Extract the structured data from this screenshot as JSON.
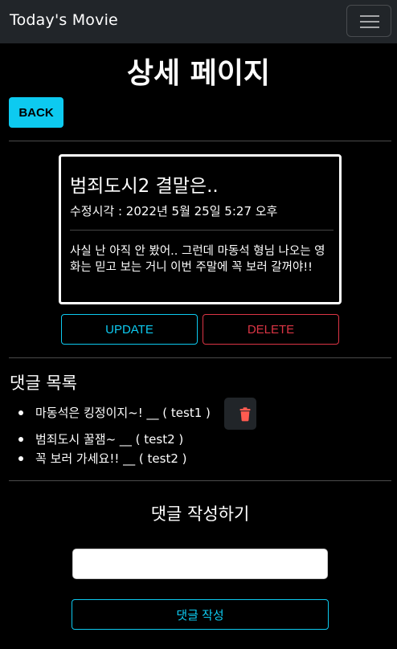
{
  "navbar": {
    "brand": "Today's Movie",
    "menu_icon": "hamburger-menu-icon"
  },
  "page": {
    "title": "상세 페이지",
    "back_label": "BACK"
  },
  "post": {
    "title": "범죄도시2 결말은..",
    "modified": "수정시각 : 2022년 5월 25일 5:27 오후",
    "body": "사실 난 아직 안 봤어.. 그런데 마동석 형님 나오는 영화는 믿고 보는 거니 이번 주말에 꼭 보러 갈꺼야!!",
    "update_label": "UPDATE",
    "delete_label": "DELETE"
  },
  "comments": {
    "heading": "댓글 목록",
    "items": [
      {
        "text": "마동석은 킹정이지~! __ ( test1 )"
      },
      {
        "text": "범죄도시 꿀잼~ __ ( test2 )"
      },
      {
        "text": "꼭 보러 가세요!! __ ( test2 )"
      }
    ],
    "delete_icon": "trash-icon"
  },
  "comment_form": {
    "heading": "댓글 작성하기",
    "input_value": "",
    "input_placeholder": "",
    "submit_label": "댓글 작성"
  },
  "colors": {
    "accent": "#0dcaf0",
    "danger": "#dc3545",
    "navbar_bg": "#212529",
    "trash": "#ff5b50"
  }
}
